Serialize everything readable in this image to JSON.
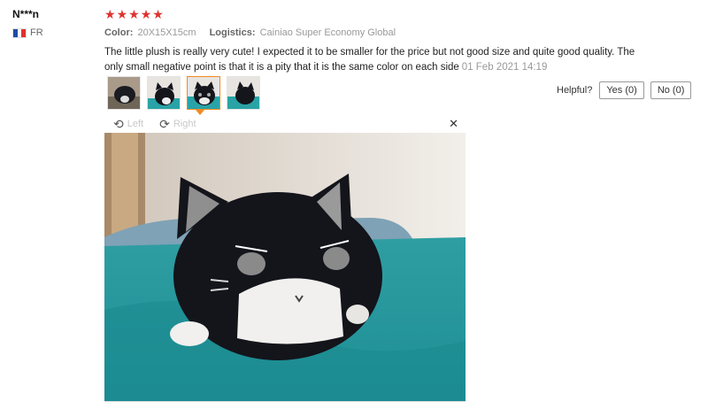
{
  "reviewer": {
    "name": "N***n",
    "country": "FR",
    "flag_colors": [
      "#1f4aa8",
      "#ffffff",
      "#e0322d"
    ]
  },
  "review": {
    "rating": 5,
    "stars": [
      "★",
      "★",
      "★",
      "★",
      "★"
    ],
    "star_color": "#e0322d",
    "color_label": "Color:",
    "color_value": "20X15X15cm",
    "logistics_label": "Logistics:",
    "logistics_value": "Cainiao Super Economy Global",
    "text": "The little plush is really very cute! I expected it to be smaller for the price but not good size and quite good quality. The only small negative point is that it is a pity that it is the same color on each side",
    "date": "01 Feb 2021 14:19"
  },
  "photos": {
    "thumbnails": [
      "thumbnail-1",
      "thumbnail-2",
      "thumbnail-3",
      "thumbnail-4"
    ],
    "selected_index": 2,
    "rotate_left": "Left",
    "rotate_right": "Right",
    "rotate_left_icon": "rotate-left-icon",
    "rotate_right_icon": "rotate-right-icon",
    "close_icon": "close-icon"
  },
  "helpful": {
    "label": "Helpful?",
    "yes": "Yes (0)",
    "no": "No (0)"
  }
}
